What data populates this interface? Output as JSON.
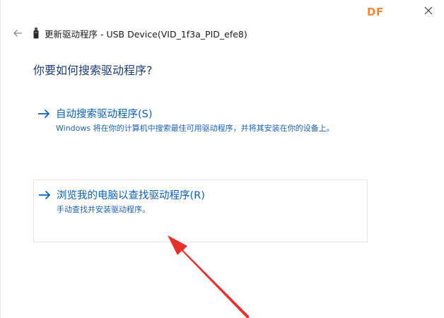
{
  "watermark": "DF",
  "header": {
    "title": "更新驱动程序 - USB Device(VID_1f3a_PID_efe8)"
  },
  "question": "你要如何搜索驱动程序?",
  "options": [
    {
      "title": "自动搜索驱动程序(S)",
      "description": "Windows 将在你的计算机中搜索最佳可用驱动程序，并将其安装在你的设备上。"
    },
    {
      "title": "浏览我的电脑以查找驱动程序(R)",
      "description": "手动查找并安装驱动程序。"
    }
  ],
  "colors": {
    "accent": "#0b5fb7",
    "question": "#1e3c78",
    "annotation_arrow": "#e8302a",
    "watermark": "#f0883a"
  },
  "icons": {
    "back": "back-arrow-icon",
    "close": "close-icon",
    "device": "usb-device-icon",
    "option": "right-arrow-icon"
  }
}
